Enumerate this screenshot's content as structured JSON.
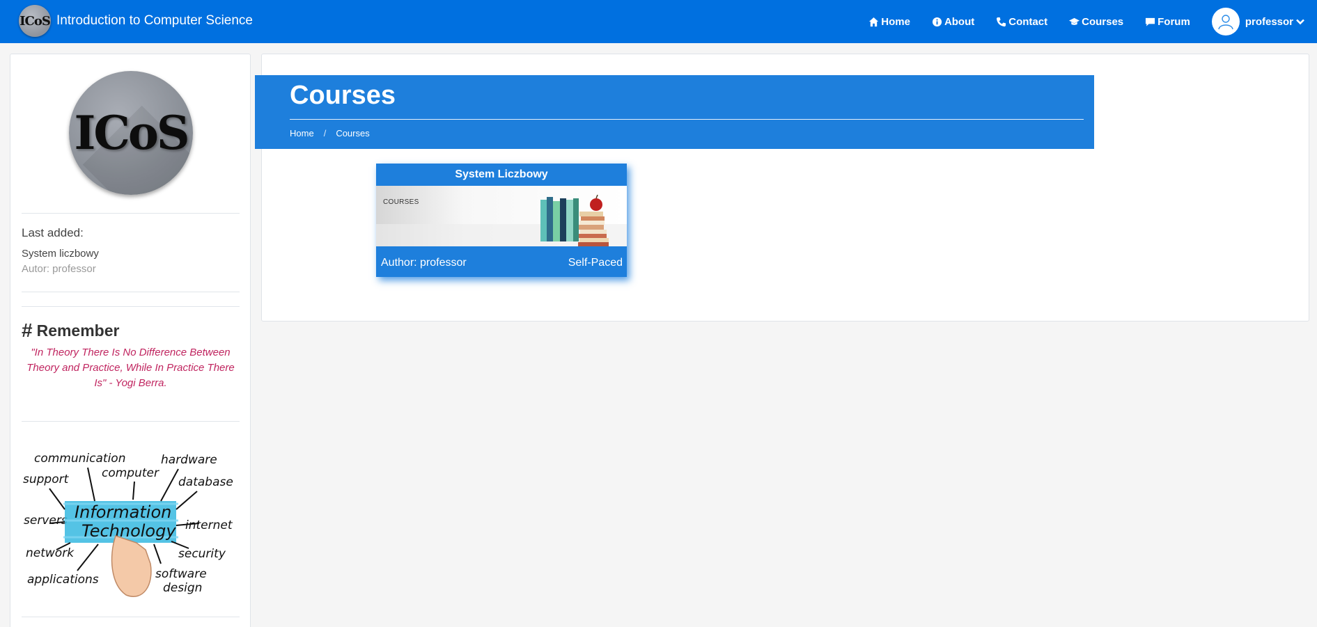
{
  "brand": {
    "logo_text": "ICoS",
    "title": "Introduction to Computer Science"
  },
  "nav": {
    "items": [
      {
        "label": "Home",
        "icon": "home-icon"
      },
      {
        "label": "About",
        "icon": "info-icon"
      },
      {
        "label": "Contact",
        "icon": "phone-icon"
      },
      {
        "label": "Courses",
        "icon": "graduation-cap-icon"
      },
      {
        "label": "Forum",
        "icon": "comment-icon"
      }
    ],
    "user": {
      "name": "professor",
      "icon": "user-avatar-icon"
    }
  },
  "sidebar": {
    "logo_text": "ICoS",
    "last_added": {
      "title": "Last added:",
      "item": "System liczbowy",
      "author": "Autor: professor"
    },
    "remember": {
      "title": "Remember",
      "quote": "\"In Theory There Is No Difference Between Theory and Practice, While In Practice There Is\" - Yogi Berra."
    },
    "it_image": {
      "center": [
        "Information",
        "Technology"
      ],
      "words": [
        "communication",
        "computer",
        "hardware",
        "support",
        "database",
        "servers",
        "internet",
        "network",
        "security",
        "applications",
        "software",
        "design"
      ]
    }
  },
  "page": {
    "title": "Courses",
    "breadcrumb": [
      "Home",
      "Courses"
    ]
  },
  "courses": [
    {
      "title": "System Liczbowy",
      "image_label": "COURSES",
      "author": "Author: professor",
      "pace": "Self-Paced"
    }
  ],
  "colors": {
    "navbar": "#0070e0",
    "accent": "#1e7fdc",
    "quote": "#c0245f"
  }
}
